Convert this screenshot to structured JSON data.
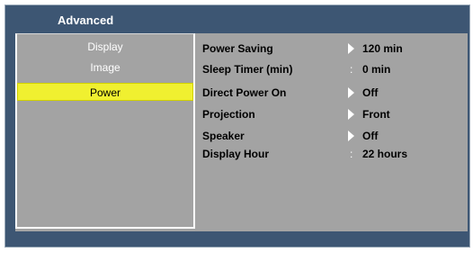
{
  "window": {
    "title": "Advanced"
  },
  "menu": {
    "items": [
      {
        "label": "Display",
        "selected": false
      },
      {
        "label": "Image",
        "selected": false
      },
      {
        "label": "Power",
        "selected": true
      }
    ]
  },
  "settings": [
    {
      "label": "Power Saving",
      "control": "arrow-right-icon",
      "value": "120 min"
    },
    {
      "label": "Sleep Timer (min)",
      "control": ":",
      "value": "0 min"
    },
    {
      "label": "Direct Power On",
      "control": "arrow-right-icon",
      "value": "Off"
    },
    {
      "label": "Projection",
      "control": "arrow-right-icon",
      "value": "Front"
    },
    {
      "label": "Speaker",
      "control": "arrow-right-icon",
      "value": "Off"
    },
    {
      "label": "Display Hour",
      "control": ":",
      "value": "22 hours"
    }
  ],
  "colors": {
    "frame": "#3d5673",
    "panel": "#a3a3a3",
    "selection": "#f0f030"
  }
}
